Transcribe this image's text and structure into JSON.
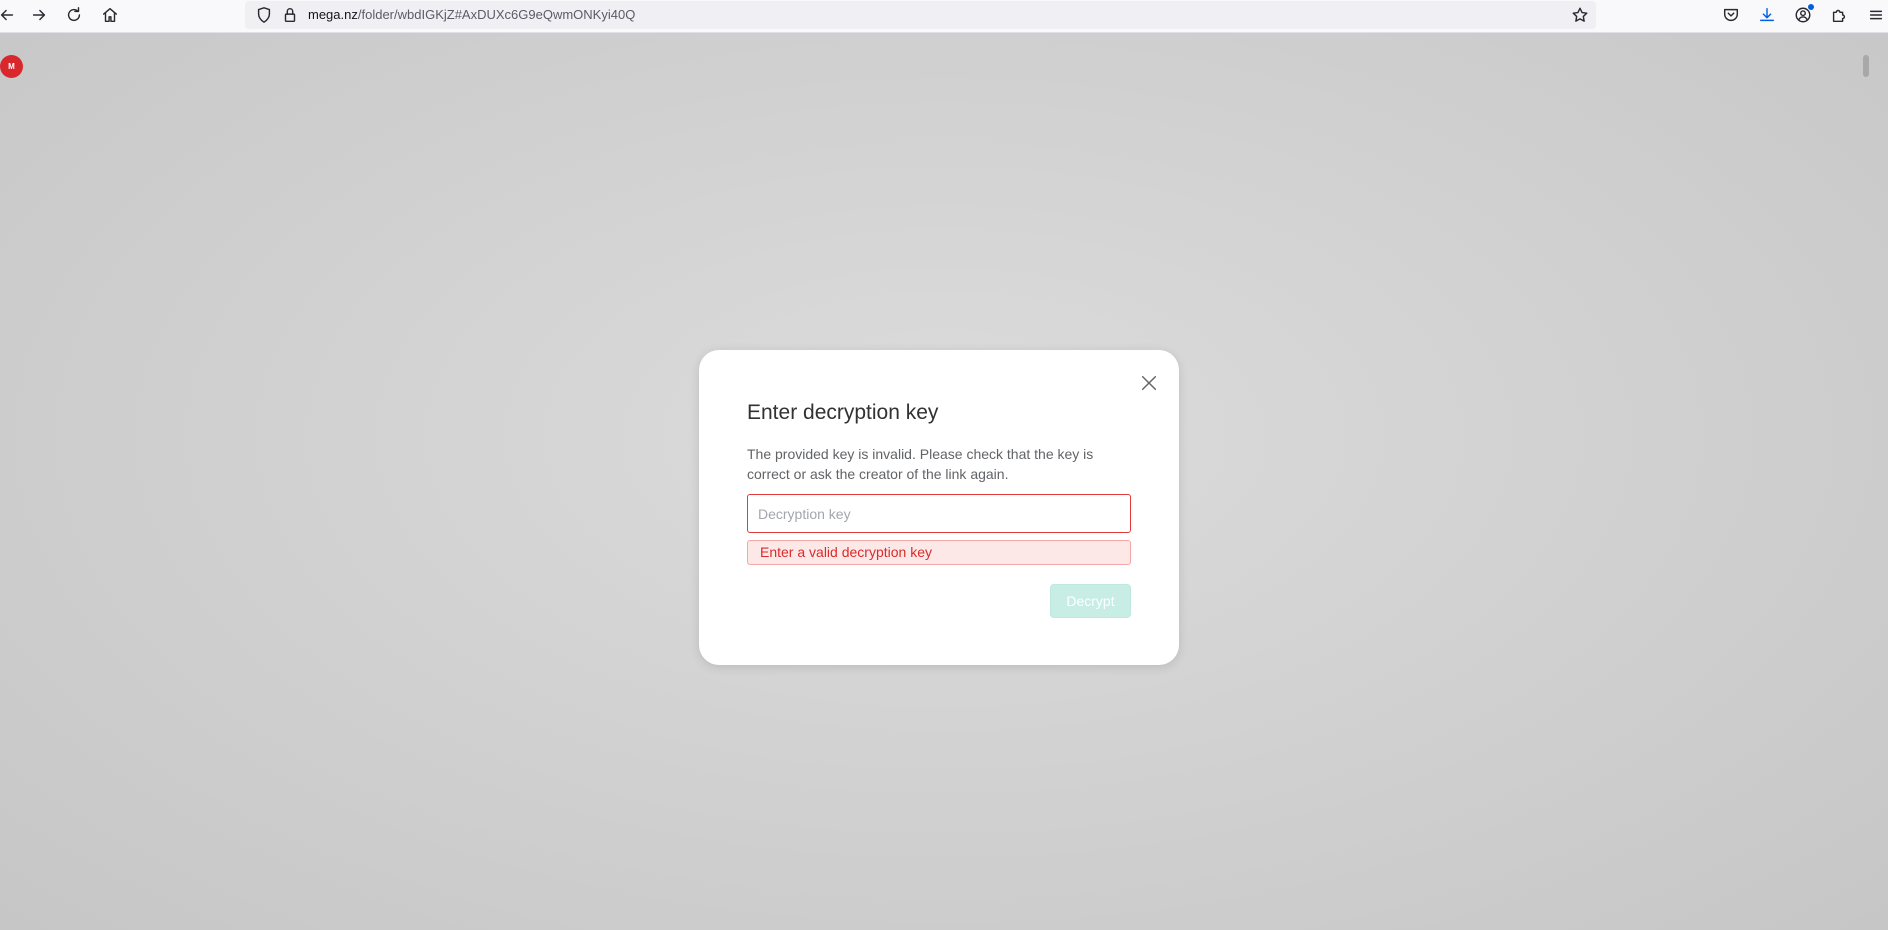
{
  "browser": {
    "url_host": "mega.nz",
    "url_path": "/folder/wbdIGKjZ#AxDUXc6G9eQwmONKyi40Q",
    "icons": {
      "back": "back-arrow-icon",
      "forward": "forward-arrow-icon",
      "reload": "reload-icon",
      "home": "home-icon",
      "shield": "shield-icon",
      "lock": "lock-icon",
      "bookmark": "star-icon",
      "pocket": "pocket-icon",
      "downloads": "download-icon",
      "account": "account-icon",
      "extensions": "puzzle-icon",
      "menu": "hamburger-menu-icon"
    }
  },
  "page": {
    "badge_icon": "mega-logo-icon"
  },
  "dialog": {
    "title": "Enter decryption key",
    "message": "The provided key is invalid. Please check that the key is correct or ask the creator of the link again.",
    "input_placeholder": "Decryption key",
    "input_value": "",
    "error": "Enter a valid decryption key",
    "submit_label": "Decrypt",
    "close_icon": "close-icon"
  },
  "colors": {
    "error_red": "#e03a3a",
    "button_teal_disabled": "#c7ede5",
    "downloads_blue": "#0061e0"
  }
}
